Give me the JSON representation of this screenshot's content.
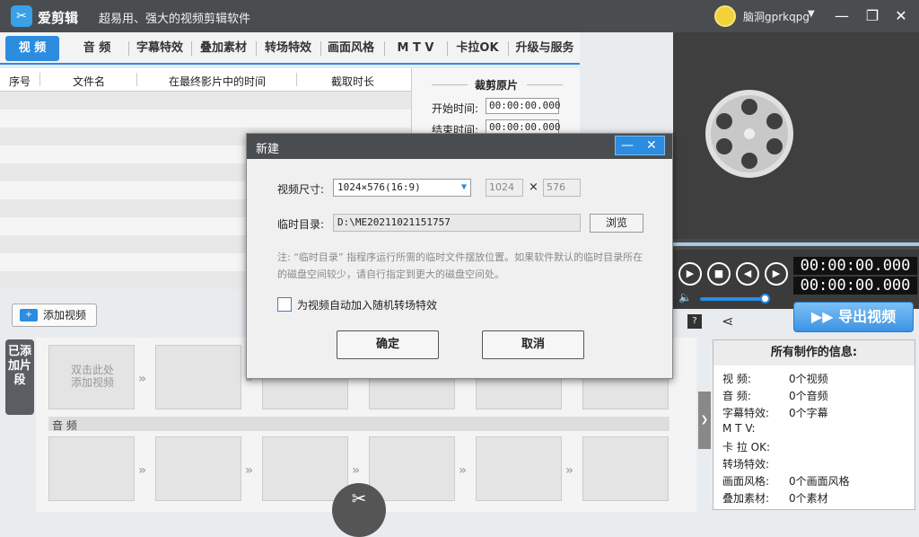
{
  "window": {
    "app_name": "爱剪辑",
    "slogan": "超易用、强大的视频剪辑软件",
    "user_name": "脑洞gprkqpg",
    "minimize_glyph": "—",
    "maximize_glyph": "❐",
    "close_glyph": "✕"
  },
  "nav": {
    "tabs": [
      {
        "label": "视 频",
        "active": true
      },
      {
        "label": "音 频"
      },
      {
        "label": "字幕特效"
      },
      {
        "label": "叠加素材"
      },
      {
        "label": "转场特效"
      },
      {
        "label": "画面风格"
      },
      {
        "label": "M T V"
      },
      {
        "label": "卡拉OK"
      },
      {
        "label": "升级与服务"
      }
    ]
  },
  "clip_table": {
    "headers": [
      "序号",
      "文件名",
      "在最终影片中的时间",
      "截取时长"
    ]
  },
  "trim": {
    "title": "裁剪原片",
    "start_label": "开始时间:",
    "start_value": "00:00:00.000",
    "end_label": "结束时间:",
    "end_value": "00:00:00.000"
  },
  "player": {
    "time_current": "00:00:00.000",
    "time_total": "00:00:00.000",
    "volume_level": 0.95
  },
  "export": {
    "label": "导出视频"
  },
  "info": {
    "title": "所有制作的信息:",
    "rows": [
      {
        "label": "视    频:",
        "value": "0个视频"
      },
      {
        "label": "音    频:",
        "value": "0个音频"
      },
      {
        "label": "字幕特效:",
        "value": "0个字幕"
      },
      {
        "label": "M  T  V:",
        "value": ""
      },
      {
        "label": "卡 拉 OK:",
        "value": ""
      },
      {
        "label": "转场特效:",
        "value": ""
      },
      {
        "label": "画面风格:",
        "value": "0个画面风格"
      },
      {
        "label": "叠加素材:",
        "value": "0个素材"
      }
    ]
  },
  "timeline": {
    "add_video_label": "添加视频",
    "side_tab_label": "已添加片段",
    "placeholder_text": "双击此处\n添加视频",
    "audio_label": "音 频"
  },
  "dialog": {
    "title": "新建",
    "size_label": "视频尺寸:",
    "size_value": "1024×576(16:9)",
    "width_value": "1024",
    "height_value": "576",
    "times_sign": "×",
    "tmp_label": "临时目录:",
    "tmp_value": "D:\\ME20211021151757",
    "browse_label": "浏览",
    "note": "注: “临时目录” 指程序运行所需的临时文件摆放位置。如果软件默认的临时目录所在的磁盘空间较少，请自行指定到更大的磁盘空间处。",
    "auto_transition_label": "为视频自动加入随机转场特效",
    "auto_transition_checked": false,
    "ok_label": "确定",
    "cancel_label": "取消"
  },
  "colors": {
    "accent": "#2b8ce0",
    "titlebar": "#4a4d50"
  }
}
